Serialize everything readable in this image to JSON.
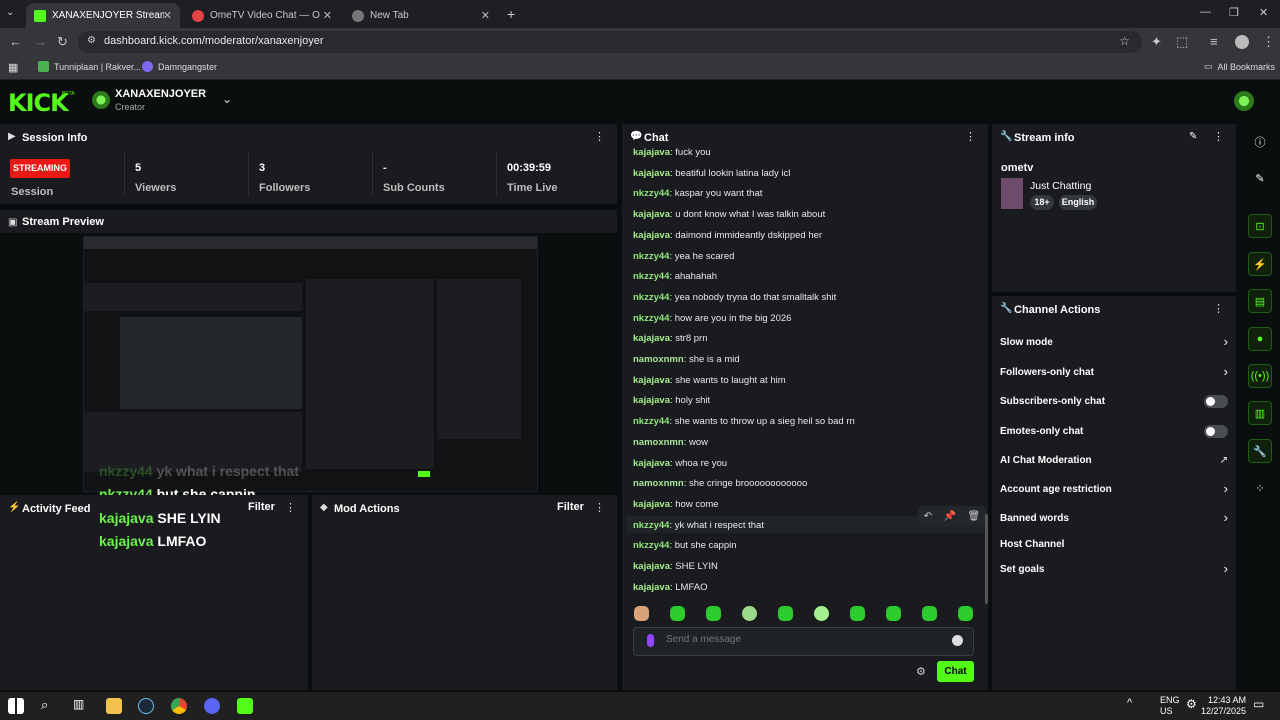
{
  "browser": {
    "tabs": [
      {
        "title": "XANAXENJOYER Stream - Kick Das",
        "active": true
      },
      {
        "title": "OmeTV Video Chat — Ome",
        "active": false
      },
      {
        "title": "New Tab",
        "active": false
      }
    ],
    "new_tab_icon": "+",
    "url": "dashboard.kick.com/moderator/xanaxenjoyer",
    "bookmarks": [
      "Tunniplaan | Rakver...",
      "Damngangster"
    ],
    "all_bookmarks": "All Bookmarks"
  },
  "header": {
    "logo": "KICK",
    "logo_beta": "BETA",
    "channel_name": "XANAXENJOYER",
    "channel_role": "Creator"
  },
  "session": {
    "title": "Session Info",
    "status_badge": "STREAMING",
    "status_label": "Session",
    "stats": [
      {
        "value": "5",
        "label": "Viewers"
      },
      {
        "value": "3",
        "label": "Followers"
      },
      {
        "value": "-",
        "label": "Sub Counts"
      },
      {
        "value": "00:39:59",
        "label": "Time Live"
      }
    ]
  },
  "preview": {
    "title": "Stream Preview",
    "overlay_chat": [
      {
        "user": "nkzzy44",
        "msg": "yk what i respect that",
        "faded": true
      },
      {
        "user": "nkzzy44",
        "msg": "but she cappin",
        "faded": false
      },
      {
        "user": "kajajava",
        "msg": "SHE LYIN",
        "faded": false
      },
      {
        "user": "kajajava",
        "msg": "LMFAO",
        "faded": false
      }
    ]
  },
  "activity_feed": {
    "title": "Activity Feed",
    "filter": "Filter"
  },
  "mod_actions": {
    "title": "Mod Actions",
    "filter": "Filter"
  },
  "chat": {
    "title": "Chat",
    "messages": [
      {
        "user": "kajajava",
        "text": "fuck you"
      },
      {
        "user": "kajajava",
        "text": "beatiful lookin latina lady icl"
      },
      {
        "user": "nkzzy44",
        "text": "kaspar you want that"
      },
      {
        "user": "kajajava",
        "text": "u dont know what I was talkin about"
      },
      {
        "user": "kajajava",
        "text": "daimond immideantly dskipped her"
      },
      {
        "user": "nkzzy44",
        "text": "yea he scared"
      },
      {
        "user": "nkzzy44",
        "text": "ahahahah"
      },
      {
        "user": "nkzzy44",
        "text": "yea nobody tryna do that smalltalk shit"
      },
      {
        "user": "nkzzy44",
        "text": "how are you in the big 2026"
      },
      {
        "user": "kajajava",
        "text": "str8 prn"
      },
      {
        "user": "namoxnmn",
        "text": "she is a mid"
      },
      {
        "user": "kajajava",
        "text": "she wants to laught at him"
      },
      {
        "user": "kajajava",
        "text": "holy shit"
      },
      {
        "user": "nkzzy44",
        "text": "she wants to throw up a sieg heil so bad rn"
      },
      {
        "user": "namoxnmn",
        "text": "wow"
      },
      {
        "user": "kajajava",
        "text": "whoa re you"
      },
      {
        "user": "namoxnmn",
        "text": "she cringe broooooooooooo"
      },
      {
        "user": "kajajava",
        "text": "how come"
      },
      {
        "user": "nkzzy44",
        "text": "yk what i respect that"
      },
      {
        "user": "nkzzy44",
        "text": "but she cappin"
      },
      {
        "user": "kajajava",
        "text": "SHE LYIN"
      },
      {
        "user": "kajajava",
        "text": "LMFAO"
      }
    ],
    "input_placeholder": "Send a message",
    "send_label": "Chat"
  },
  "stream_info": {
    "title": "Stream info",
    "stream_title": "ometv",
    "category": "Just Chatting",
    "tags": [
      "18+",
      "English"
    ]
  },
  "channel_actions": {
    "title": "Channel Actions",
    "items": [
      {
        "label": "Slow mode",
        "control": "chevron"
      },
      {
        "label": "Followers-only chat",
        "control": "chevron"
      },
      {
        "label": "Subscribers-only chat",
        "control": "toggle"
      },
      {
        "label": "Emotes-only chat",
        "control": "toggle"
      },
      {
        "label": "AI Chat Moderation",
        "control": "external"
      },
      {
        "label": "Account age restriction",
        "control": "chevron"
      },
      {
        "label": "Banned words",
        "control": "chevron"
      },
      {
        "label": "Host Channel",
        "control": "none"
      },
      {
        "label": "Set goals",
        "control": "chevron"
      }
    ]
  },
  "taskbar": {
    "lang_top": "ENG",
    "lang_bottom": "US",
    "time": "12:43 AM",
    "date": "12/27/2025"
  },
  "colors": {
    "accent": "#53fc18",
    "live": "#e91916",
    "panel": "#191b1f",
    "bg": "#0b0e0f"
  }
}
